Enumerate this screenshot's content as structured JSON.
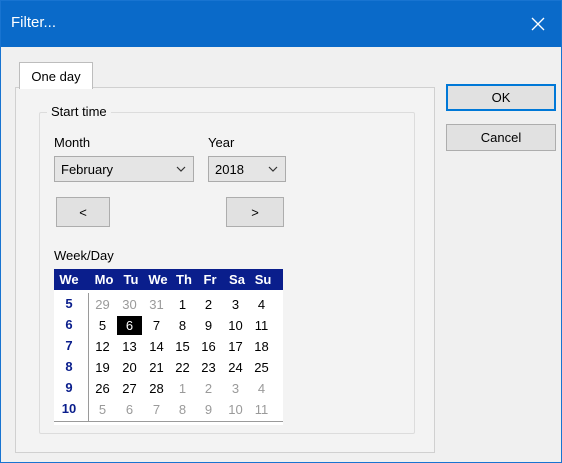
{
  "dialog": {
    "title": "Filter..."
  },
  "tabs": [
    {
      "label": "One day"
    }
  ],
  "start_time": {
    "legend": "Start time",
    "month_label": "Month",
    "month_value": "February",
    "year_label": "Year",
    "year_value": "2018",
    "prev_label": "<",
    "next_label": ">",
    "weekday_label": "Week/Day"
  },
  "buttons": {
    "ok": "OK",
    "cancel": "Cancel"
  },
  "calendar": {
    "header": [
      "We",
      "Mo",
      "Tu",
      "We",
      "Th",
      "Fr",
      "Sa",
      "Su"
    ],
    "weeks": [
      {
        "week": "5",
        "days": [
          {
            "d": "29",
            "other": true
          },
          {
            "d": "30",
            "other": true
          },
          {
            "d": "31",
            "other": true
          },
          {
            "d": "1"
          },
          {
            "d": "2"
          },
          {
            "d": "3"
          },
          {
            "d": "4"
          }
        ]
      },
      {
        "week": "6",
        "days": [
          {
            "d": "5"
          },
          {
            "d": "6",
            "selected": true
          },
          {
            "d": "7"
          },
          {
            "d": "8"
          },
          {
            "d": "9"
          },
          {
            "d": "10"
          },
          {
            "d": "11"
          }
        ]
      },
      {
        "week": "7",
        "days": [
          {
            "d": "12"
          },
          {
            "d": "13"
          },
          {
            "d": "14"
          },
          {
            "d": "15"
          },
          {
            "d": "16"
          },
          {
            "d": "17"
          },
          {
            "d": "18"
          }
        ]
      },
      {
        "week": "8",
        "days": [
          {
            "d": "19"
          },
          {
            "d": "20"
          },
          {
            "d": "21"
          },
          {
            "d": "22"
          },
          {
            "d": "23"
          },
          {
            "d": "24"
          },
          {
            "d": "25"
          }
        ]
      },
      {
        "week": "9",
        "days": [
          {
            "d": "26"
          },
          {
            "d": "27"
          },
          {
            "d": "28"
          },
          {
            "d": "1",
            "other": true
          },
          {
            "d": "2",
            "other": true
          },
          {
            "d": "3",
            "other": true
          },
          {
            "d": "4",
            "other": true
          }
        ]
      },
      {
        "week": "10",
        "days": [
          {
            "d": "5",
            "other": true
          },
          {
            "d": "6",
            "other": true
          },
          {
            "d": "7",
            "other": true
          },
          {
            "d": "8",
            "other": true
          },
          {
            "d": "9",
            "other": true
          },
          {
            "d": "10",
            "other": true
          },
          {
            "d": "11",
            "other": true
          }
        ]
      }
    ]
  }
}
